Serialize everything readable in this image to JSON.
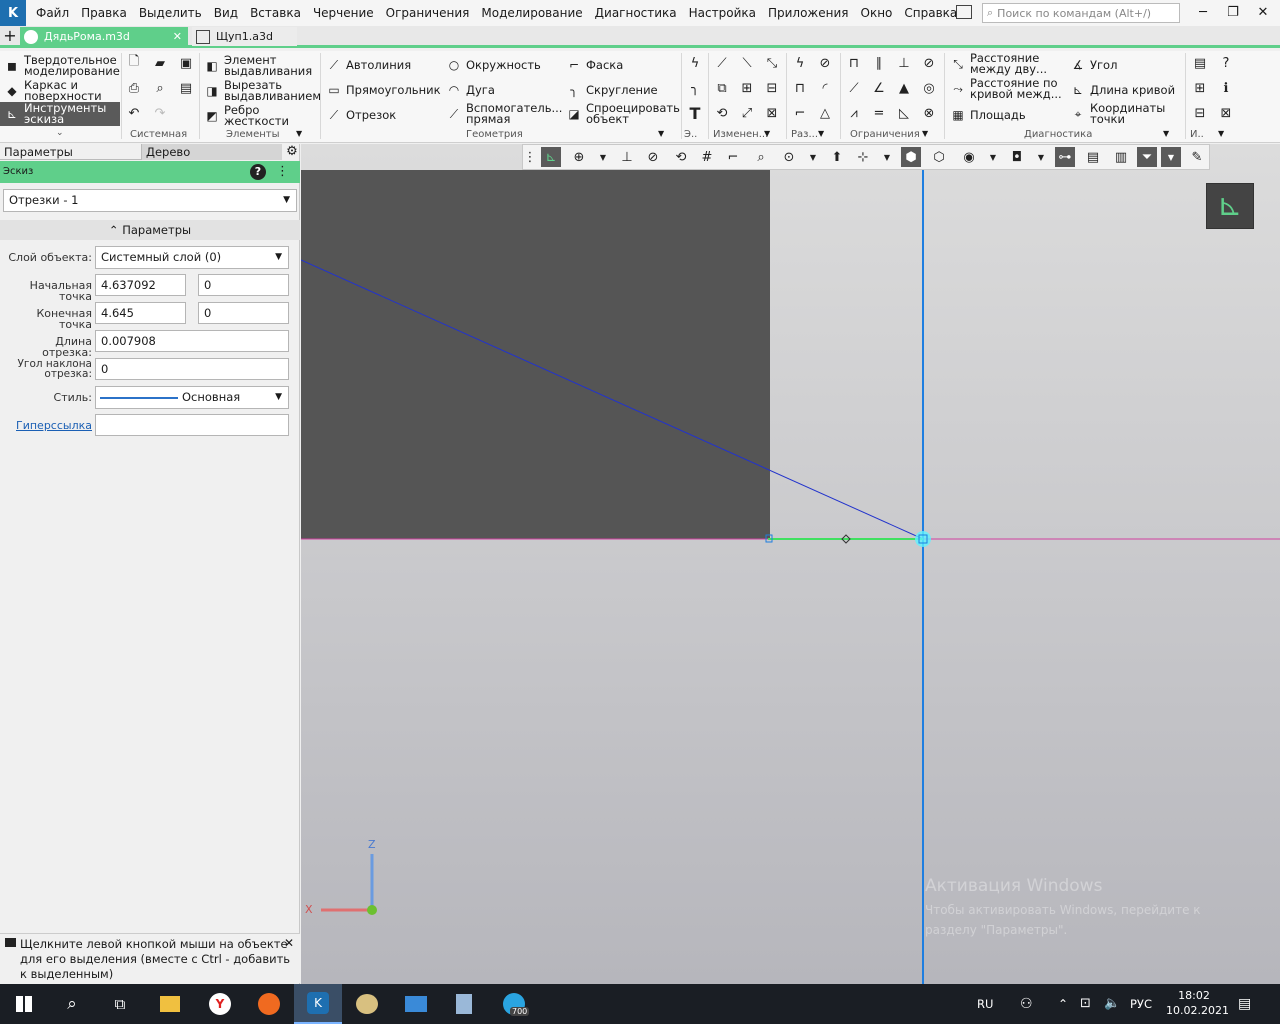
{
  "app": {
    "logo": "K"
  },
  "menu": [
    "Файл",
    "Правка",
    "Выделить",
    "Вид",
    "Вставка",
    "Черчение",
    "Ограничения",
    "Моделирование",
    "Диагностика",
    "Настройка",
    "Приложения",
    "Окно",
    "Справка"
  ],
  "search": {
    "placeholder": "Поиск по командам (Alt+/)"
  },
  "tabs": {
    "active": "ДядьРома.m3d",
    "second": "Щуп1.a3d"
  },
  "ribbon": {
    "modes": {
      "solid": "Твердотельное моделирование",
      "frame": "Каркас и поверхности",
      "sketch": "Инструменты эскиза"
    },
    "elements": {
      "extrude": "Элемент выдавливания",
      "cut": "Вырезать выдавливанием",
      "rib": "Ребро жесткости"
    },
    "geometry": {
      "polyline": "Автолиния",
      "rect": "Прямоугольник",
      "segment": "Отрезок",
      "circle": "Окружность",
      "arc": "Дуга",
      "aux": "Вспомогатель... прямая",
      "chamfer": "Фаска",
      "fillet": "Скругление",
      "project": "Спроецировать объект"
    },
    "diagnostics": {
      "dist": "Расстояние между дву...",
      "dist_curve": "Расстояние по кривой межд...",
      "area": "Площадь",
      "angle": "Угол",
      "curve_len": "Длина кривой",
      "coords": "Координаты точки"
    },
    "groups": {
      "system": "Системная",
      "elements": "Элементы",
      "geometry": "Геометрия",
      "d": "Э..",
      "edit": "Изменен...",
      "dim": "Раз...",
      "constraints": "Ограничения",
      "diag": "Диагностика",
      "other": "И.."
    }
  },
  "panel": {
    "tab_params": "Параметры",
    "tab_tree": "Дерево",
    "sketch_label": "Эскиз",
    "selector": "Отрезки - 1",
    "section": "Параметры",
    "layer_label": "Слой объекта:",
    "layer_value": "Системный слой (0)",
    "start_label": "Начальная точка",
    "start_x": "4.637092",
    "start_y": "0",
    "end_label": "Конечная точка",
    "end_x": "4.645",
    "end_y": "0",
    "length_label": "Длина отрезка:",
    "length_value": "0.007908",
    "angle_label": "Угол наклона отрезка:",
    "angle_value": "0",
    "style_label": "Стиль:",
    "style_value": "Основная",
    "hyperlink_label": "Гиперссылка",
    "hyperlink_value": ""
  },
  "hint": "Щелкните левой кнопкой мыши на объекте для его выделения (вместе с Ctrl - добавить к выделенным)",
  "axes": {
    "z": "Z",
    "x": "X"
  },
  "watermark": {
    "title": "Активация Windows",
    "text": "Чтобы активировать Windows, перейдите к разделу \"Параметры\"."
  },
  "taskbar": {
    "lang": "RU",
    "kbd": "РУС",
    "time": "18:02",
    "date": "10.02.2021",
    "badge": "700"
  }
}
